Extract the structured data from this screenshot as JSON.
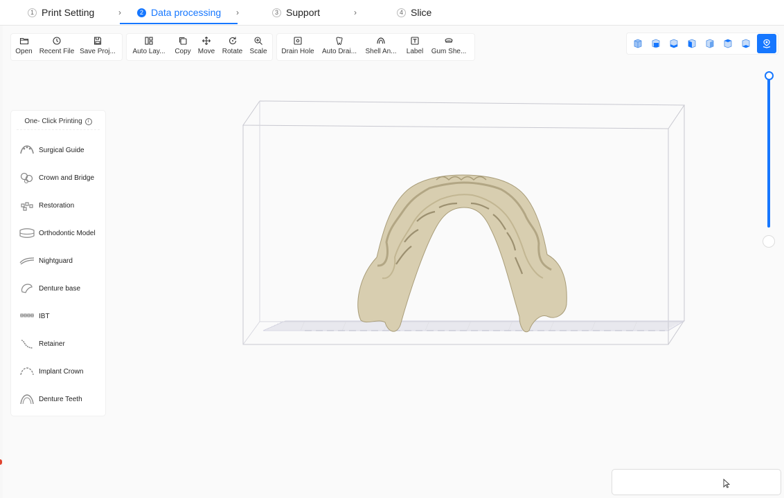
{
  "stepper": {
    "steps": [
      {
        "num": "1",
        "label": "Print Setting"
      },
      {
        "num": "2",
        "label": "Data processing"
      },
      {
        "num": "3",
        "label": "Support"
      },
      {
        "num": "4",
        "label": "Slice"
      }
    ],
    "active_index": 1,
    "separator": "›"
  },
  "toolbar": {
    "file": [
      {
        "label": "Open",
        "icon": "folder-icon"
      },
      {
        "label": "Recent File",
        "icon": "clock-icon"
      },
      {
        "label": "Save Proj...",
        "icon": "save-icon"
      }
    ],
    "transform": [
      {
        "label": "Auto Lay...",
        "icon": "layout-icon"
      },
      {
        "label": "Copy",
        "icon": "copy-icon"
      },
      {
        "label": "Move",
        "icon": "move-icon"
      },
      {
        "label": "Rotate",
        "icon": "rotate-icon"
      },
      {
        "label": "Scale",
        "icon": "zoom-icon"
      }
    ],
    "modify": [
      {
        "label": "Drain Hole",
        "icon": "drain-hole-icon"
      },
      {
        "label": "Auto Drai...",
        "icon": "tooth-icon"
      },
      {
        "label": "Shell An...",
        "icon": "shell-icon"
      },
      {
        "label": "Label",
        "icon": "text-icon"
      },
      {
        "label": "Gum She...",
        "icon": "gum-icon"
      }
    ]
  },
  "view_buttons": [
    "view-iso-icon",
    "view-front-icon",
    "view-back-icon",
    "view-left-icon",
    "view-right-icon",
    "view-top-icon",
    "view-bottom-icon",
    "view-model-icon"
  ],
  "left_panel": {
    "title": "One- Click Printing",
    "info_glyph": "i",
    "items": [
      {
        "label": "Surgical Guide"
      },
      {
        "label": "Crown and Bridge"
      },
      {
        "label": "Restoration"
      },
      {
        "label": "Orthodontic Model"
      },
      {
        "label": "Nightguard"
      },
      {
        "label": "Denture base"
      },
      {
        "label": "IBT"
      },
      {
        "label": "Retainer"
      },
      {
        "label": "Implant Crown"
      },
      {
        "label": "Denture Teeth"
      }
    ]
  },
  "colors": {
    "accent": "#1677ff",
    "model": "#d8ceb0",
    "build_box": "#c8c8d0"
  }
}
